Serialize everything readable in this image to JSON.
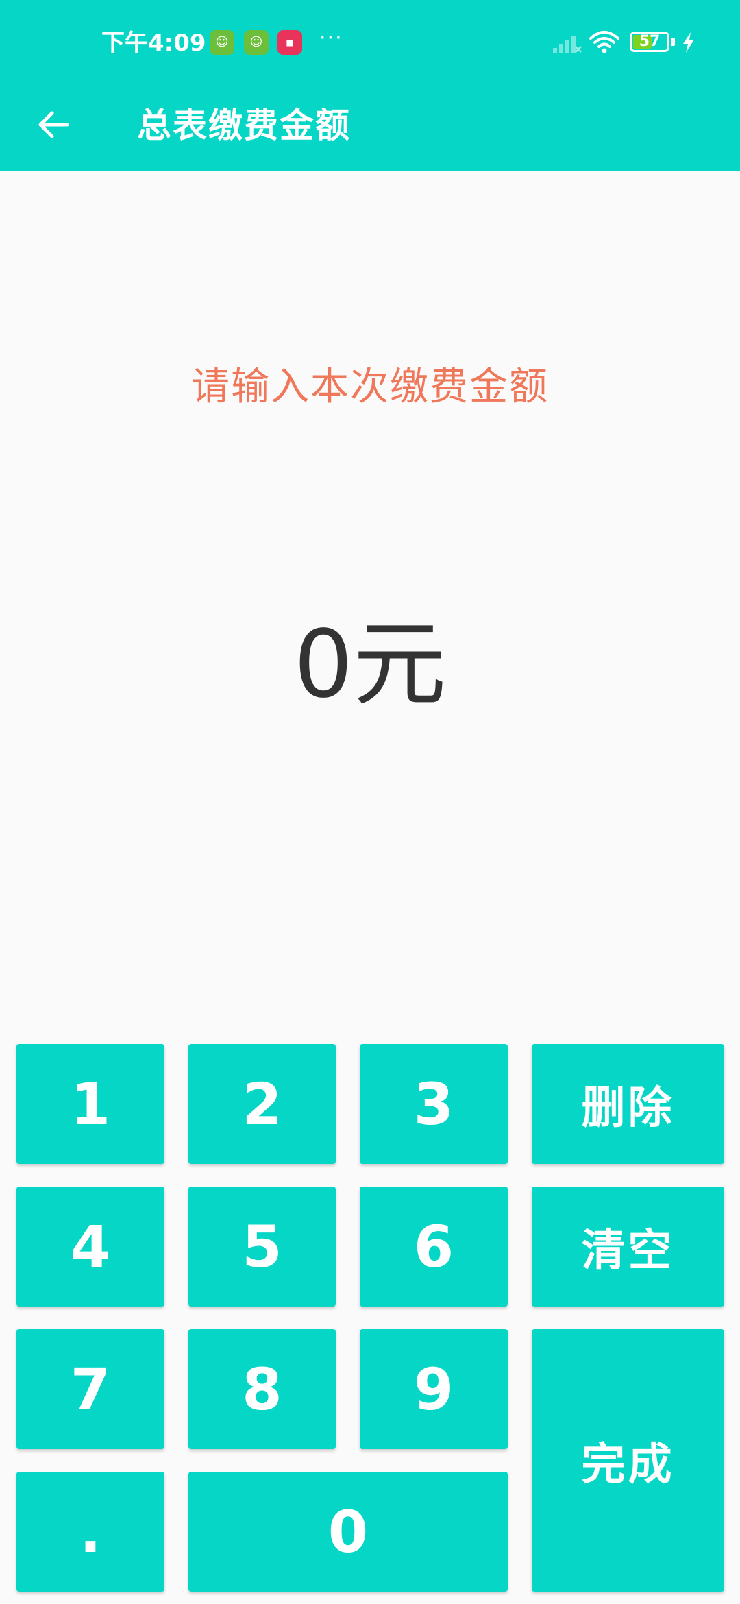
{
  "status_bar": {
    "time": "下午4:09",
    "more": "···",
    "battery_level": "57",
    "battery_fraction": 0.57,
    "charging": true
  },
  "app_bar": {
    "title": "总表缴费金额",
    "back_icon": "arrow-left-icon"
  },
  "main": {
    "prompt": "请输入本次缴费金额",
    "amount": "0元"
  },
  "keypad": {
    "key_1": "1",
    "key_2": "2",
    "key_3": "3",
    "key_4": "4",
    "key_5": "5",
    "key_6": "6",
    "key_7": "7",
    "key_8": "8",
    "key_9": "9",
    "key_0": "0",
    "key_dot": ".",
    "delete_label": "删除",
    "clear_label": "清空",
    "done_label": "完成"
  },
  "colors": {
    "primary": "#05d6c6",
    "prompt_text": "#f0785a",
    "amount_text": "#333333",
    "background": "#fafafa"
  }
}
